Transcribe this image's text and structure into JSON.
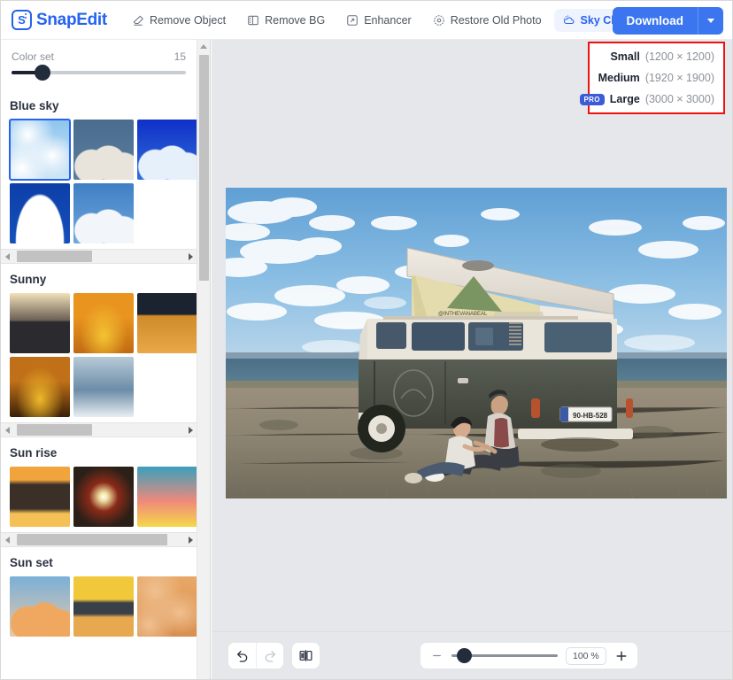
{
  "app": {
    "name": "SnapEdit",
    "logo_letter": "S"
  },
  "toolbar": {
    "tools": [
      {
        "label": "Remove Object",
        "icon": "eraser-icon",
        "active": false
      },
      {
        "label": "Remove BG",
        "icon": "remove-bg-icon",
        "active": false
      },
      {
        "label": "Enhancer",
        "icon": "enhancer-icon",
        "active": false
      },
      {
        "label": "Restore Old Photo",
        "icon": "restore-photo-icon",
        "active": false
      },
      {
        "label": "Sky Changer",
        "icon": "sky-changer-icon",
        "active": true
      }
    ],
    "download_label": "Download",
    "download_caret_icon": "chevron-down-icon"
  },
  "size_menu": {
    "items": [
      {
        "name": "Small",
        "dimensions": "(1200 × 1200)",
        "pro": false,
        "pro_label": ""
      },
      {
        "name": "Medium",
        "dimensions": "(1920 × 1900)",
        "pro": false,
        "pro_label": ""
      },
      {
        "name": "Large",
        "dimensions": "(3000 × 3000)",
        "pro": true,
        "pro_label": "PRO"
      }
    ],
    "highlight_color": "#ee1111"
  },
  "sidebar": {
    "color_set": {
      "label": "Color set",
      "value": "15"
    },
    "categories": [
      {
        "title": "Blue sky",
        "thumbnails": [
          {
            "name": "blue-sky-1",
            "selected": true,
            "c1": "#8ec5ee",
            "c2": "#cfe5f6",
            "c3": "#ffffff",
            "style": "wispy"
          },
          {
            "name": "blue-sky-2",
            "selected": false,
            "c1": "#4a6d8f",
            "c2": "#5b7c9c",
            "c3": "#e8e4dc",
            "style": "cumulus"
          },
          {
            "name": "blue-sky-3",
            "selected": false,
            "c1": "#1030c8",
            "c2": "#2f6fd8",
            "c3": "#e6f0fb",
            "style": "cumulus"
          },
          {
            "name": "blue-sky-4",
            "selected": false,
            "c1": "#4d8fd0",
            "c2": "#9cc8ea",
            "c3": "#ffffff",
            "style": "wispy"
          },
          {
            "name": "blue-sky-5",
            "selected": false,
            "c1": "#0d3fa8",
            "c2": "#1550bb",
            "c3": "#ffffff",
            "style": "bigcloud"
          },
          {
            "name": "blue-sky-6",
            "selected": false,
            "c1": "#3f7fc4",
            "c2": "#6fa8dc",
            "c3": "#f2f6fa",
            "style": "cumulus"
          }
        ],
        "hscroll_pos": 0
      },
      {
        "title": "Sunny",
        "thumbnails": [
          {
            "name": "sunny-1",
            "selected": false,
            "c1": "#f2e0b8",
            "c2": "#6b6055",
            "c3": "#2b2b2f",
            "style": "seaset"
          },
          {
            "name": "sunny-2",
            "selected": false,
            "c1": "#e8941f",
            "c2": "#f5c333",
            "c3": "#c06a12",
            "style": "golden"
          },
          {
            "name": "sunny-3",
            "selected": false,
            "c1": "#1b2230",
            "c2": "#d08a2a",
            "c3": "#e8a948",
            "style": "dune"
          },
          {
            "name": "sunny-4",
            "selected": false,
            "c1": "#6b2020",
            "c2": "#c8412a",
            "c3": "#f0e0d0",
            "style": "redsun"
          },
          {
            "name": "sunny-5",
            "selected": false,
            "c1": "#c07018",
            "c2": "#f0b82a",
            "c3": "#3a2008",
            "style": "golden"
          },
          {
            "name": "sunny-6",
            "selected": false,
            "c1": "#b8cad8",
            "c2": "#6c8ca8",
            "c3": "#e8eef2",
            "style": "aerial"
          }
        ],
        "hscroll_pos": 0
      },
      {
        "title": "Sun rise",
        "thumbnails": [
          {
            "name": "sunrise-1",
            "selected": false,
            "c1": "#f2a43c",
            "c2": "#3a3028",
            "c3": "#f5c056",
            "style": "darkcloud"
          },
          {
            "name": "sunrise-2",
            "selected": false,
            "c1": "#2a2018",
            "c2": "#f0e0a0",
            "c3": "#8a2a18",
            "style": "burst"
          },
          {
            "name": "sunrise-3",
            "selected": false,
            "c1": "#3aa0bc",
            "c2": "#f08a7a",
            "c3": "#f5d84a",
            "style": "pastel"
          },
          {
            "name": "sunrise-4",
            "selected": false,
            "c1": "#d8c8a8",
            "c2": "#f0e8c8",
            "c3": "#48505c",
            "style": "seaset"
          }
        ],
        "hscroll_pos": 0
      },
      {
        "title": "Sun set",
        "thumbnails": [
          {
            "name": "sunset-1",
            "selected": false,
            "c1": "#7ab0d8",
            "c2": "#e8c8a8",
            "c3": "#f0a860",
            "style": "cumulus"
          },
          {
            "name": "sunset-2",
            "selected": false,
            "c1": "#f0c83a",
            "c2": "#3a4048",
            "c3": "#e8a850",
            "style": "band"
          },
          {
            "name": "sunset-3",
            "selected": false,
            "c1": "#e8a868",
            "c2": "#d89050",
            "c3": "#f0c090",
            "style": "wispy"
          }
        ],
        "hscroll_pos": 0
      }
    ]
  },
  "canvas": {
    "image_alt": "Volkswagen camper van with pop-top roof parked on a coastal field, couple sitting against the rear",
    "background_color": "#e5e7eb"
  },
  "bottombar": {
    "undo_icon": "undo-icon",
    "redo_icon": "redo-icon",
    "compare_icon": "compare-split-icon",
    "zoom_out_icon": "minus-icon",
    "zoom_in_icon": "plus-icon",
    "zoom_value": "100 %"
  }
}
